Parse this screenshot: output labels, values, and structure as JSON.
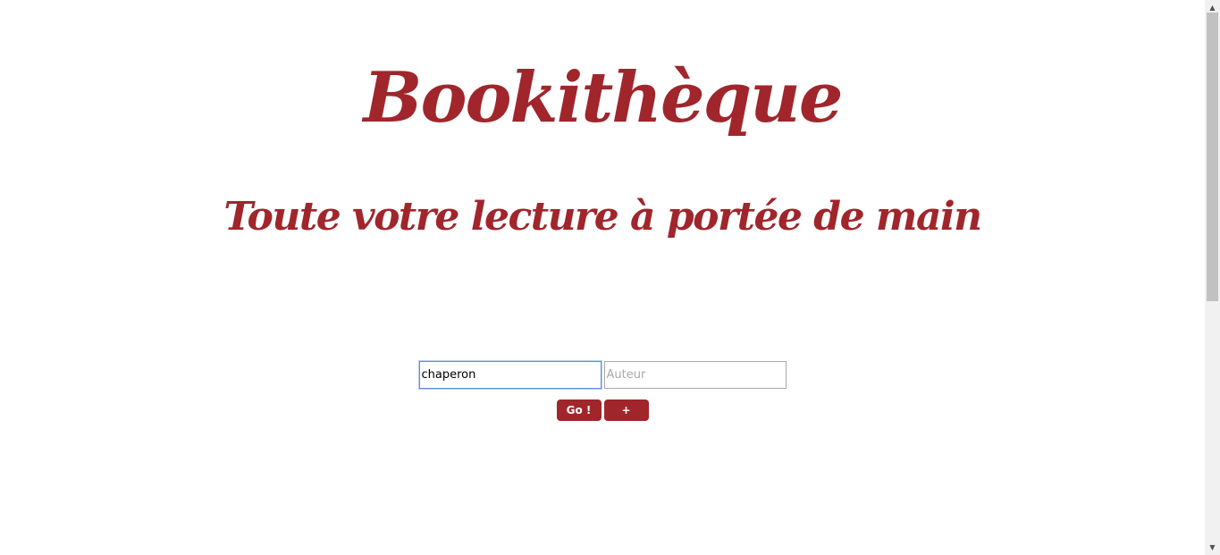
{
  "header": {
    "title": "Bookithèque",
    "subtitle": "Toute votre lecture à portée de main"
  },
  "search": {
    "title_value": "chaperon",
    "author_placeholder": "Auteur",
    "author_value": "",
    "go_label": "Go !",
    "add_label": "+"
  },
  "scrollbar": {
    "up_icon": "▲",
    "down_icon": "▼"
  },
  "colors": {
    "brand": "#a0262c",
    "focus_border": "#5e8ed6"
  }
}
